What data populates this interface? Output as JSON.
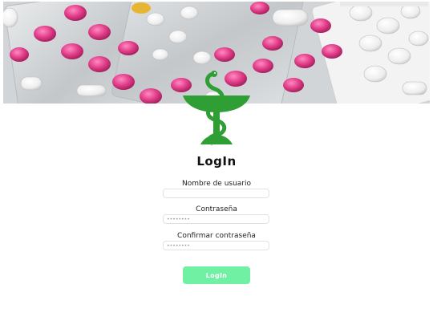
{
  "header": {
    "image_name": "pills-blister-banner"
  },
  "logo": {
    "icon": "bowl-of-hygieia-icon",
    "color": "#2f9e34"
  },
  "form": {
    "title": "LogIn",
    "username_label": "Nombre de usuario",
    "username_value": "",
    "password_label": "Contraseña",
    "password_value": "••••••••",
    "confirm_label": "Confirmar contraseña",
    "confirm_value": "••••••••",
    "submit_label": "LogIn"
  },
  "colors": {
    "accent": "#6ff0a3",
    "logo_green": "#2f9e34",
    "pill_pink": "#e0468f"
  }
}
